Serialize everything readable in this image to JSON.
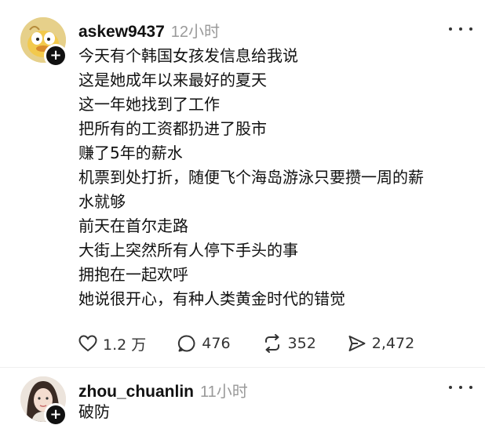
{
  "posts": [
    {
      "username": "askew9437",
      "time": "12小时",
      "lines": [
        "今天有个韩国女孩发信息给我说",
        "这是她成年以来最好的夏天",
        "这一年她找到了工作",
        "把所有的工资都扔进了股市",
        "赚了5年的薪水",
        "机票到处打折，随便飞个海岛游泳只要攒一周的薪",
        "水就够",
        "前天在首尔走路",
        "大街上突然所有人停下手头的事",
        "拥抱在一起欢呼",
        "她说很开心，有种人类黄金时代的错觉"
      ],
      "stats": {
        "likes": "1.2 万",
        "comments": "476",
        "reposts": "352",
        "shares": "2,472"
      }
    },
    {
      "username": "zhou_chuanlin",
      "time": "11小时",
      "lines": [
        "破防"
      ]
    }
  ],
  "icons": {
    "like": "heart-icon",
    "comment": "comment-icon",
    "repost": "repost-icon",
    "share": "send-icon",
    "more": "more-dots-icon",
    "follow": "plus-icon"
  }
}
